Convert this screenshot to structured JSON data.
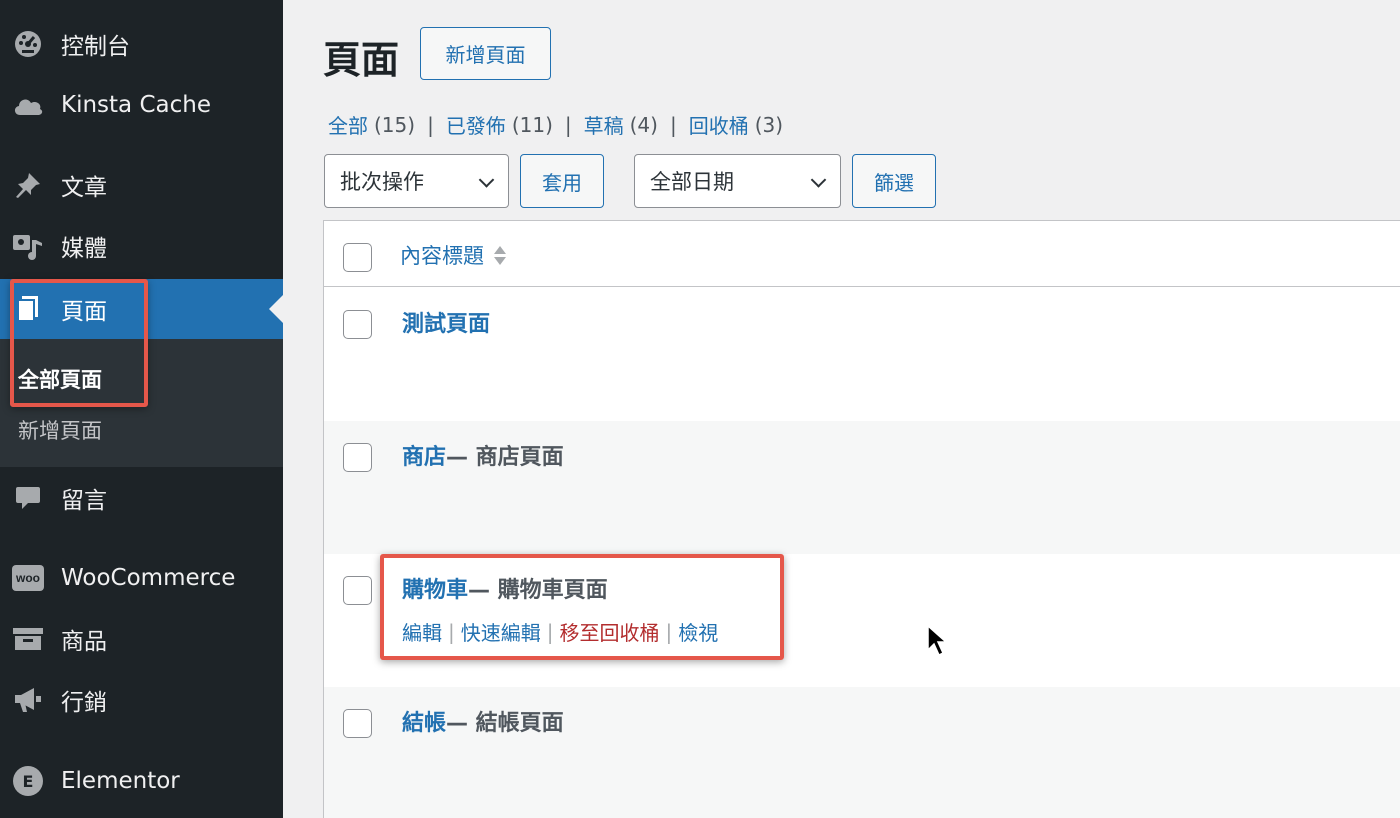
{
  "sidebar": {
    "items": [
      {
        "label": "控制台",
        "icon": "dashboard-icon"
      },
      {
        "label": "Kinsta Cache",
        "icon": "cloud-icon"
      },
      {
        "label": "文章",
        "icon": "pin-icon"
      },
      {
        "label": "媒體",
        "icon": "media-icon"
      },
      {
        "label": "頁面",
        "icon": "page-icon",
        "current": true
      },
      {
        "label": "留言",
        "icon": "comment-icon"
      },
      {
        "label": "WooCommerce",
        "icon": "woo-icon"
      },
      {
        "label": "商品",
        "icon": "archive-icon"
      },
      {
        "label": "行銷",
        "icon": "megaphone-icon"
      },
      {
        "label": "Elementor",
        "icon": "elementor-icon"
      }
    ],
    "submenu": {
      "current": "全部頁面",
      "other": "新增頁面"
    },
    "woo_icon_text": "woo",
    "elementor_icon_text": "E"
  },
  "header": {
    "title": "頁面",
    "add_new": "新增頁面"
  },
  "filters": {
    "all": {
      "label": "全部",
      "count": "(15)"
    },
    "published": {
      "label": "已發佈",
      "count": "(11)"
    },
    "drafts": {
      "label": "草稿",
      "count": "(4)"
    },
    "trash": {
      "label": "回收桶",
      "count": "(3)"
    },
    "separator": "|"
  },
  "tablenav": {
    "bulk_action": "批次操作",
    "apply": "套用",
    "date": "全部日期",
    "filter": "篩選"
  },
  "table": {
    "column_title": "內容標題",
    "rows": [
      {
        "title": "測試頁面",
        "state": ""
      },
      {
        "title": "商店",
        "state": " — 商店頁面"
      },
      {
        "title": "購物車",
        "state": " — 購物車頁面",
        "actions": {
          "edit": "編輯",
          "quick_edit": "快速編輯",
          "trash": "移至回收桶",
          "view": "檢視",
          "sep": "|"
        }
      },
      {
        "title": "結帳",
        "state": " — 結帳頁面"
      }
    ]
  },
  "colors": {
    "sidebar_bg": "#1d2327",
    "accent": "#2271b1",
    "highlight": "#e5574a",
    "trash": "#b32d2e"
  }
}
